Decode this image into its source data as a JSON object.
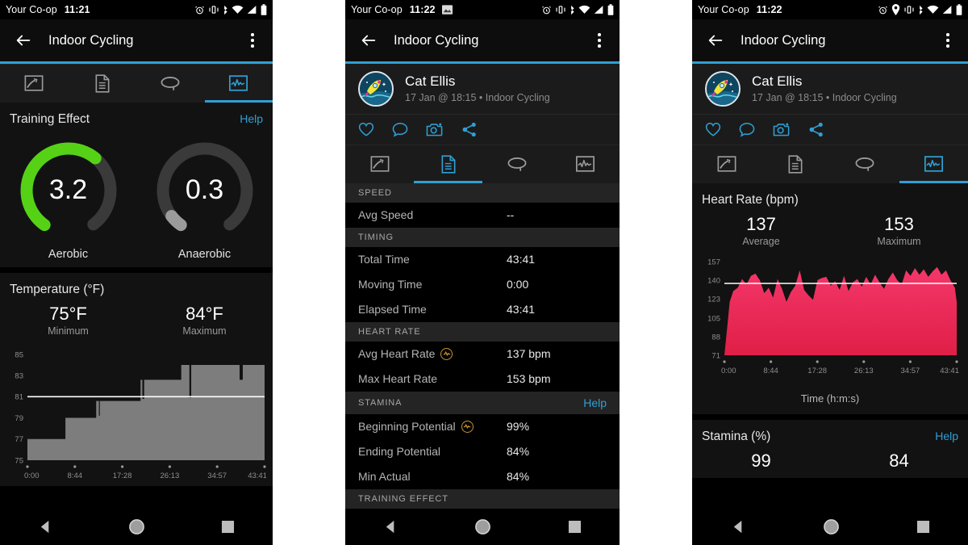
{
  "accent": "#2f9fd4",
  "statusbar": {
    "carrier": "Your Co-op",
    "time_1": "11:21",
    "time_2": "11:22",
    "time_3": "11:22",
    "icons_1": [
      "alarm-icon",
      "vibrate-icon",
      "bluetooth-icon",
      "wifi-icon",
      "signal-icon",
      "battery-icon"
    ],
    "icons_2": [
      "screenshot-icon",
      "alarm-icon",
      "vibrate-icon",
      "bluetooth-icon",
      "wifi-icon",
      "signal-icon",
      "battery-icon"
    ],
    "icons_3": [
      "alarm-icon",
      "location-icon",
      "vibrate-icon",
      "bluetooth-icon",
      "wifi-icon",
      "signal-icon",
      "battery-icon"
    ]
  },
  "appbar": {
    "back_icon": "arrow-left-icon",
    "title": "Indoor Cycling",
    "overflow_icon": "more-vertical-icon"
  },
  "user": {
    "avatar_icon": "rocket-avatar",
    "name": "Cat Ellis",
    "meta": "17 Jan @ 18:15 • Indoor Cycling"
  },
  "social": [
    {
      "name": "like-icon",
      "label": "Like"
    },
    {
      "name": "comment-icon",
      "label": "Comment"
    },
    {
      "name": "photo-icon",
      "label": "Add photo"
    },
    {
      "name": "share-icon",
      "label": "Share"
    }
  ],
  "tabs": [
    {
      "name": "tab-map",
      "icon": "map-icon",
      "selected_panel1": false,
      "selected_panel2": false,
      "selected_panel3": false
    },
    {
      "name": "tab-details",
      "icon": "details-icon",
      "selected_panel1": false,
      "selected_panel2": true,
      "selected_panel3": false
    },
    {
      "name": "tab-laps",
      "icon": "laps-icon",
      "selected_panel1": false,
      "selected_panel2": false,
      "selected_panel3": false
    },
    {
      "name": "tab-graphs",
      "icon": "graph-icon",
      "selected_panel1": true,
      "selected_panel2": false,
      "selected_panel3": true
    }
  ],
  "panel1": {
    "training_effect": {
      "title": "Training Effect",
      "help": "Help",
      "aerobic": {
        "value": "3.2",
        "label": "Aerobic",
        "max": 5,
        "color": "#55d216"
      },
      "anaerobic": {
        "value": "0.3",
        "label": "Anaerobic",
        "max": 5,
        "color": "#9b9b9b"
      }
    },
    "temperature": {
      "title": "Temperature (°F)",
      "minimum": {
        "value": "75°F",
        "caption": "Minimum"
      },
      "maximum": {
        "value": "84°F",
        "caption": "Maximum"
      }
    }
  },
  "panel2": {
    "sections": [
      {
        "header": "SPEED",
        "help": null,
        "rows": [
          {
            "label": "Avg Speed",
            "value": "--",
            "badge": false
          }
        ]
      },
      {
        "header": "TIMING",
        "help": null,
        "rows": [
          {
            "label": "Total Time",
            "value": "43:41",
            "badge": false
          },
          {
            "label": "Moving Time",
            "value": "0:00",
            "badge": false
          },
          {
            "label": "Elapsed Time",
            "value": "43:41",
            "badge": false
          }
        ]
      },
      {
        "header": "HEART RATE",
        "help": null,
        "rows": [
          {
            "label": "Avg Heart Rate",
            "value": "137 bpm",
            "badge": true
          },
          {
            "label": "Max Heart Rate",
            "value": "153 bpm",
            "badge": false
          }
        ]
      },
      {
        "header": "STAMINA",
        "help": "Help",
        "rows": [
          {
            "label": "Beginning Potential",
            "value": "99%",
            "badge": true
          },
          {
            "label": "Ending Potential",
            "value": "84%",
            "badge": false
          },
          {
            "label": "Min Actual",
            "value": "84%",
            "badge": false
          }
        ]
      },
      {
        "header": "TRAINING EFFECT",
        "help": null,
        "rows": []
      }
    ]
  },
  "panel3": {
    "heart_rate": {
      "title": "Heart Rate (bpm)",
      "average": {
        "value": "137",
        "caption": "Average"
      },
      "maximum": {
        "value": "153",
        "caption": "Maximum"
      },
      "axis_caption": "Time (h:m:s)"
    },
    "stamina": {
      "title": "Stamina (%)",
      "help": "Help",
      "begin": "99",
      "end": "84"
    }
  },
  "navbar": [
    {
      "name": "nav-back-button",
      "icon": "triangle-back-icon"
    },
    {
      "name": "nav-home-button",
      "icon": "circle-home-icon"
    },
    {
      "name": "nav-recents-button",
      "icon": "square-recents-icon"
    }
  ],
  "chart_data": [
    {
      "type": "area",
      "id": "temperature-chart",
      "title": "Temperature (°F)",
      "xlabel": "",
      "ylabel": "°F",
      "ylim": [
        75,
        85.6
      ],
      "yticks": [
        85,
        83,
        81,
        79,
        77,
        75
      ],
      "xticks": [
        "0:00",
        "8:44",
        "17:28",
        "26:13",
        "34:57",
        "43:41"
      ],
      "xlim": [
        0,
        2621
      ],
      "average_line": 81,
      "min": 75,
      "max": 84,
      "fill_color": "#7d7d7d",
      "grid": false,
      "x": [
        0,
        60,
        180,
        300,
        420,
        520,
        620,
        700,
        760,
        790,
        800,
        830,
        880,
        980,
        1080,
        1180,
        1250,
        1270,
        1290,
        1330,
        1450,
        1600,
        1700,
        1760,
        1790,
        1810,
        1850,
        1950,
        2100,
        2250,
        2320,
        2345,
        2380,
        2500,
        2621
      ],
      "y": [
        77,
        77,
        77,
        77,
        79,
        79,
        79,
        79,
        80.6,
        79.2,
        80.6,
        80.6,
        80.6,
        80.6,
        80.6,
        80.6,
        82.6,
        80.8,
        82.6,
        82.6,
        82.6,
        82.6,
        84,
        84,
        80.9,
        84,
        84,
        84,
        84,
        84,
        84,
        82.6,
        84,
        84,
        84
      ]
    },
    {
      "type": "area",
      "id": "heart-rate-chart",
      "title": "Heart Rate (bpm)",
      "xlabel": "Time (h:m:s)",
      "ylabel": "bpm",
      "ylim": [
        71,
        160
      ],
      "yticks": [
        157,
        140,
        123,
        105,
        88,
        71
      ],
      "xticks": [
        "0:00",
        "8:44",
        "17:28",
        "26:13",
        "34:57",
        "43:41"
      ],
      "xlim": [
        0,
        2621
      ],
      "average_line": 137,
      "average": 137,
      "maximum": 153,
      "fill_color_top": "#f4376a",
      "fill_color_bottom": "#e01f47",
      "grid": false,
      "x": [
        0,
        30,
        60,
        100,
        150,
        200,
        250,
        300,
        350,
        400,
        450,
        500,
        550,
        600,
        650,
        700,
        750,
        800,
        850,
        900,
        950,
        1000,
        1050,
        1100,
        1150,
        1200,
        1250,
        1300,
        1350,
        1400,
        1450,
        1500,
        1550,
        1600,
        1650,
        1700,
        1750,
        1800,
        1850,
        1900,
        1950,
        2000,
        2050,
        2100,
        2150,
        2200,
        2250,
        2300,
        2350,
        2400,
        2450,
        2500,
        2550,
        2600,
        2621
      ],
      "y": [
        71,
        95,
        120,
        130,
        133,
        141,
        136,
        144,
        146,
        140,
        128,
        133,
        124,
        141,
        132,
        120,
        129,
        135,
        149,
        131,
        126,
        122,
        140,
        142,
        143,
        135,
        139,
        131,
        144,
        130,
        138,
        141,
        134,
        143,
        136,
        145,
        138,
        132,
        141,
        147,
        140,
        136,
        149,
        144,
        151,
        145,
        150,
        143,
        148,
        152,
        145,
        149,
        140,
        133,
        120
      ]
    },
    {
      "type": "table",
      "id": "stamina-values",
      "title": "Stamina (%)",
      "categories": [
        "Beginning",
        "Ending"
      ],
      "values": [
        99,
        84
      ]
    }
  ]
}
